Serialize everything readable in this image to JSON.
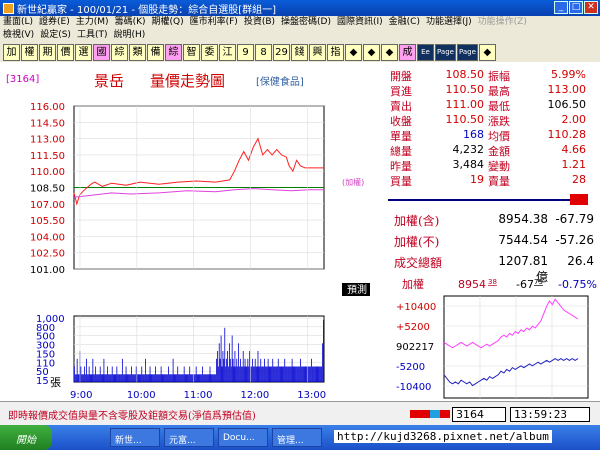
{
  "window": {
    "title": "新世紀贏家 - 100/01/21 - 個股走勢：綜合自選股[群組一]"
  },
  "menu": {
    "row1": [
      {
        "label": "畫面(L)",
        "disabled": false
      },
      {
        "label": "證券(E)",
        "disabled": false
      },
      {
        "label": "主力(M)",
        "disabled": false
      },
      {
        "label": "籌碼(K)",
        "disabled": false
      },
      {
        "label": "期權(Q)",
        "disabled": false
      },
      {
        "label": "匯市利率(F)",
        "disabled": false
      },
      {
        "label": "投資(B)",
        "disabled": false
      },
      {
        "label": "操盤密碼(D)",
        "disabled": false
      },
      {
        "label": "國際資訊(I)",
        "disabled": false
      },
      {
        "label": "金融(C)",
        "disabled": false
      },
      {
        "label": "功能選擇(J)",
        "disabled": false
      },
      {
        "label": "功能操作(Z)",
        "disabled": true
      }
    ],
    "row2": [
      {
        "label": "檢視(V)",
        "disabled": false
      },
      {
        "label": "設定(S)",
        "disabled": false
      },
      {
        "label": "工具(T)",
        "disabled": false
      },
      {
        "label": "說明(H)",
        "disabled": false
      }
    ]
  },
  "toolbar": [
    {
      "label": "加",
      "style": "yellow"
    },
    {
      "label": "權",
      "style": "yellow"
    },
    {
      "label": "期",
      "style": "yellow"
    },
    {
      "label": "價",
      "style": "yellow"
    },
    {
      "label": "選",
      "style": "yellow"
    },
    {
      "label": "國",
      "style": "pink"
    },
    {
      "label": "綜",
      "style": "yellow"
    },
    {
      "label": "類",
      "style": "yellow"
    },
    {
      "label": "備",
      "style": "yellow"
    },
    {
      "label": "綜",
      "style": "pink"
    },
    {
      "label": "智",
      "style": "yellow"
    },
    {
      "label": "委",
      "style": "yellow"
    },
    {
      "label": "江",
      "style": "yellow"
    },
    {
      "label": "9",
      "style": "yellow"
    },
    {
      "label": "8",
      "style": "yellow"
    },
    {
      "label": "29",
      "style": "yellow"
    },
    {
      "label": "錢",
      "style": "yellow"
    },
    {
      "label": "興",
      "style": "yellow"
    },
    {
      "label": "指",
      "style": "yellow"
    },
    {
      "label": "◆",
      "style": "yellow"
    },
    {
      "label": "◆",
      "style": "yellow"
    },
    {
      "label": "◆",
      "style": "yellow"
    },
    {
      "label": "成",
      "style": "pink"
    },
    {
      "label": "Ee",
      "style": "dark"
    },
    {
      "label": "Page",
      "style": "dark"
    },
    {
      "label": "Page",
      "style": "dark"
    },
    {
      "label": "◆",
      "style": "yellow"
    }
  ],
  "chart": {
    "code": "[3164]",
    "stock_name": "景岳",
    "title": "量價走勢圖",
    "category": "[保健食品]",
    "weighted_label": "(加權)",
    "forecast_label": "預測",
    "volume_unit": "張"
  },
  "chart_data": {
    "type": "line",
    "price_axis": {
      "ticks": [
        "116.00",
        "114.50",
        "113.00",
        "111.50",
        "110.00",
        "108.50",
        "107.00",
        "105.50",
        "104.00",
        "102.50",
        "101.00"
      ],
      "ylim": [
        101.0,
        116.0
      ],
      "reference": 108.5
    },
    "volume_axis": {
      "ticks": [
        "1,000",
        "800",
        "500",
        "300",
        "150",
        "110",
        "50",
        "15"
      ]
    },
    "x_ticks": [
      "9:00",
      "10:00",
      "11:00",
      "12:00",
      "13:00"
    ],
    "series": [
      {
        "kind": "price",
        "color": "#ff2020",
        "points": [
          [
            0,
            108.0
          ],
          [
            3,
            107.0
          ],
          [
            6,
            107.8
          ],
          [
            10,
            108.2
          ],
          [
            14,
            108.5
          ],
          [
            18,
            108.8
          ],
          [
            22,
            109.0
          ],
          [
            30,
            108.6
          ],
          [
            40,
            108.9
          ],
          [
            55,
            108.7
          ],
          [
            70,
            109.0
          ],
          [
            90,
            108.8
          ],
          [
            110,
            109.0
          ],
          [
            130,
            109.1
          ],
          [
            150,
            109.0
          ],
          [
            165,
            109.2
          ],
          [
            170,
            110.0
          ],
          [
            175,
            111.0
          ],
          [
            180,
            111.8
          ],
          [
            185,
            111.0
          ],
          [
            190,
            112.2
          ],
          [
            195,
            113.0
          ],
          [
            200,
            111.5
          ],
          [
            205,
            112.0
          ],
          [
            210,
            111.5
          ],
          [
            215,
            112.0
          ],
          [
            220,
            111.5
          ],
          [
            225,
            111.3
          ],
          [
            228,
            110.5
          ],
          [
            232,
            110.0
          ],
          [
            236,
            111.0
          ],
          [
            240,
            110.5
          ],
          [
            245,
            110.3
          ],
          [
            255,
            110.3
          ],
          [
            265,
            110.3
          ]
        ]
      },
      {
        "kind": "weighted_index",
        "color": "#e040e0",
        "points": [
          [
            0,
            107.6
          ],
          [
            20,
            107.8
          ],
          [
            40,
            108.0
          ],
          [
            60,
            107.9
          ],
          [
            90,
            108.0
          ],
          [
            120,
            108.2
          ],
          [
            150,
            108.1
          ],
          [
            170,
            108.3
          ],
          [
            190,
            108.4
          ],
          [
            210,
            108.3
          ],
          [
            230,
            108.2
          ],
          [
            250,
            108.3
          ],
          [
            265,
            108.3
          ]
        ]
      }
    ],
    "volume_bars": [
      2,
      1,
      1,
      3,
      1,
      1,
      4,
      2,
      1,
      1,
      1,
      2,
      1,
      3,
      1,
      1,
      2,
      1,
      1,
      1,
      3,
      1,
      1,
      2,
      1,
      1,
      1,
      1,
      2,
      1,
      1,
      1,
      3,
      1,
      1,
      1,
      2,
      1,
      1,
      1,
      1,
      2,
      1,
      1,
      1,
      1,
      2,
      1,
      1,
      1,
      1,
      1,
      3,
      1,
      1,
      1,
      2,
      1,
      1,
      1,
      1,
      1,
      2,
      1,
      1,
      1,
      1,
      2,
      1,
      1,
      1,
      1,
      1,
      2,
      1,
      1,
      1,
      3,
      1,
      1,
      1,
      1,
      2,
      1,
      1,
      1,
      1,
      1,
      2,
      1,
      1,
      1,
      1,
      1,
      2,
      1,
      1,
      1,
      1,
      1,
      1,
      1,
      2,
      1,
      1,
      1,
      1,
      3,
      1,
      1,
      1,
      1,
      2,
      1,
      1,
      1,
      1,
      1,
      1,
      2,
      1,
      1,
      1,
      1,
      1,
      2,
      1,
      1,
      1,
      1,
      1,
      1,
      2,
      1,
      1,
      1,
      1,
      1,
      1,
      2,
      1,
      1,
      1,
      1,
      1,
      1,
      1,
      2,
      1,
      1,
      1,
      1,
      1,
      1,
      3,
      4,
      2,
      5,
      3,
      6,
      2,
      4,
      3,
      7,
      2,
      3,
      4,
      2,
      5,
      3,
      2,
      6,
      3,
      2,
      4,
      2,
      3,
      2,
      5,
      2,
      3,
      2,
      2,
      4,
      2,
      3,
      2,
      2,
      3,
      2,
      4,
      2,
      2,
      3,
      2,
      2,
      3,
      2,
      2,
      4,
      2,
      2,
      3,
      2,
      2,
      2,
      3,
      2,
      2,
      2,
      3,
      2,
      2,
      2,
      2,
      3,
      2,
      2,
      2,
      2,
      2,
      3,
      2,
      2,
      2,
      2,
      2,
      2,
      3,
      2,
      2,
      2,
      2,
      2,
      2,
      2,
      3,
      2,
      2,
      2,
      2,
      2,
      2,
      2,
      2,
      3,
      2,
      2,
      2,
      2,
      2,
      2,
      2,
      2,
      2,
      2,
      2,
      3,
      2,
      2,
      2,
      2,
      2,
      2,
      2,
      2,
      2,
      2,
      2,
      5,
      8
    ]
  },
  "quote": {
    "rows": [
      {
        "l1": "開盤",
        "v1": "108.50",
        "c1": "red",
        "l2": "振幅",
        "v2": "5.99%",
        "c2": "red"
      },
      {
        "l1": "買進",
        "v1": "110.50",
        "c1": "red",
        "l2": "最高",
        "v2": "113.00",
        "c2": "red"
      },
      {
        "l1": "賣出",
        "v1": "111.00",
        "c1": "red",
        "l2": "最低",
        "v2": "106.50",
        "c2": "black"
      },
      {
        "l1": "收盤",
        "v1": "110.50",
        "c1": "red",
        "l2": "漲跌",
        "v2": "2.00",
        "c2": "red"
      },
      {
        "l1": "單量",
        "v1": "168",
        "c1": "blue",
        "l2": "均價",
        "v2": "110.28",
        "c2": "red"
      },
      {
        "l1": "總量",
        "v1": "4,232",
        "c1": "black",
        "l2": "金額",
        "v2": "4.66",
        "c2": "red"
      },
      {
        "l1": "昨量",
        "v1": "3,484",
        "c1": "black",
        "l2": "變動",
        "v2": "1.21",
        "c2": "red"
      },
      {
        "l1": "買量",
        "v1": "19",
        "c1": "red",
        "l2": "賣量",
        "v2": "28",
        "c2": "red"
      }
    ]
  },
  "indices": [
    {
      "label": "加權(含)",
      "value": "8954.38",
      "change": "-67.79"
    },
    {
      "label": "加權(不)",
      "value": "7544.54",
      "change": "-57.26"
    },
    {
      "label": "成交總額",
      "value": "1207.81億",
      "change": "26.4"
    }
  ],
  "mini_chart": {
    "label": "加權",
    "value": "8954",
    "value_decimal": "38",
    "change": "-67",
    "change_decimal": "79",
    "percent": "-0.75%",
    "axis": [
      "+10400",
      "+5200",
      "902217",
      "-5200",
      "-10400"
    ],
    "series": [
      {
        "color": "#ff40ff",
        "values": [
          2,
          1,
          0,
          -1,
          0,
          1,
          2,
          1,
          0,
          1,
          2,
          1,
          0,
          -1,
          0,
          1,
          0,
          1,
          2,
          3,
          5,
          6,
          5,
          7,
          6,
          8,
          7,
          9,
          8,
          10,
          9,
          11,
          10,
          12,
          14,
          18,
          22,
          25,
          23,
          26,
          24,
          22,
          20,
          19,
          18,
          17,
          16,
          15
        ]
      },
      {
        "color": "#2020c0",
        "values": [
          -16,
          -18,
          -20,
          -21,
          -20,
          -21,
          -19,
          -20,
          -21,
          -20,
          -22,
          -21,
          -20,
          -19,
          -18,
          -19,
          -17,
          -18,
          -17,
          -16,
          -14,
          -15,
          -13,
          -14,
          -12,
          -13,
          -12,
          -11,
          -12,
          -11,
          -10,
          -11,
          -10,
          -9,
          -10,
          -9,
          -8,
          -9,
          -8,
          -7,
          -8,
          -7,
          -8,
          -7,
          -8,
          -7,
          -8,
          -7
        ]
      }
    ]
  },
  "status": {
    "note": "即時報價成交值與量不含零股及鉅額交易(淨值爲預估值)",
    "code": "3164",
    "time": "13:59:23"
  },
  "taskbar": {
    "start": "開始",
    "items": [
      "新世...",
      "元富...",
      "Docu...",
      "管理..."
    ]
  },
  "watermark": "http://kujd3268.pixnet.net/album"
}
